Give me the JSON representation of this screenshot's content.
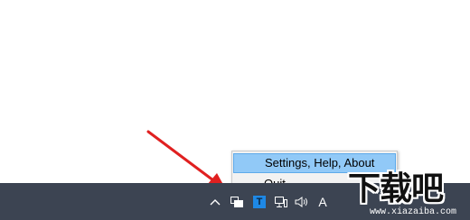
{
  "context_menu": {
    "items": [
      {
        "label": "Settings, Help, About",
        "highlighted": true
      },
      {
        "label": "Quit",
        "highlighted": false
      }
    ]
  },
  "taskbar": {
    "tray_icons": [
      "chevron-up-icon",
      "app-windows-icon",
      "t-app-icon",
      "network-icon",
      "volume-icon",
      "input-language-icon"
    ],
    "input_language_label": "A",
    "t_app_label": "T",
    "colors": {
      "taskbar": "#3c4452",
      "menu_highlight": "#91c9f7",
      "t_app": "#1e88e5",
      "arrow": "#e02020"
    }
  },
  "watermark": {
    "sub": "www.xiazaiba.com"
  }
}
